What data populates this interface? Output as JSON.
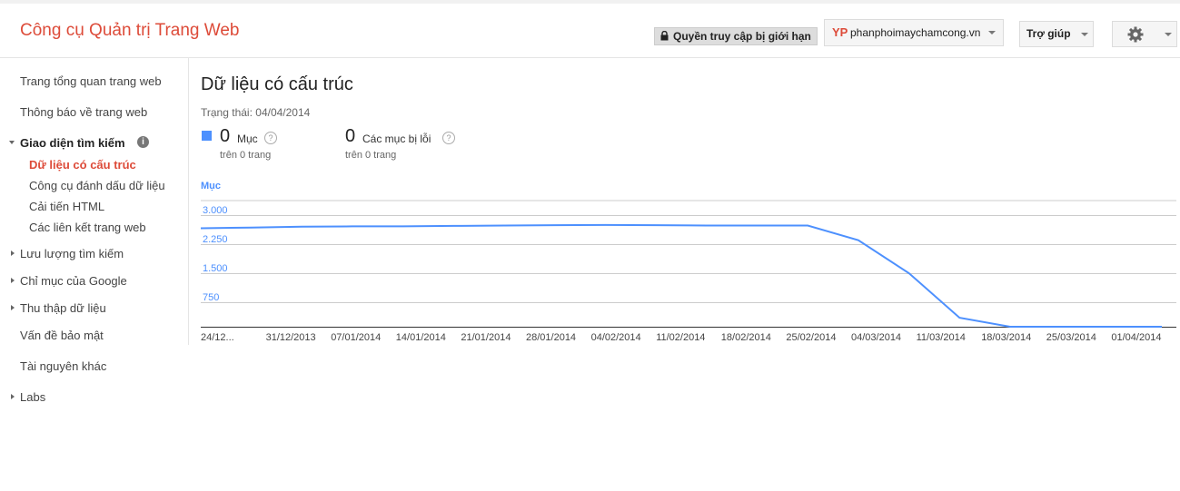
{
  "header": {
    "app_title": "Công cụ Quản trị Trang Web",
    "limited_access": "Quyền truy cập bị giới hạn",
    "site_logo": "YP",
    "site_name": "phanphoimaychamcong.vn",
    "help_label": "Trợ giúp"
  },
  "sidebar": {
    "overview": "Trang tổng quan trang web",
    "messages": "Thông báo về trang web",
    "search_appearance": "Giao diện tìm kiếm",
    "structured_data": "Dữ liệu có cấu trúc",
    "data_highlighter": "Công cụ đánh dấu dữ liệu",
    "html_improvements": "Cải tiến HTML",
    "sitelinks": "Các liên kết trang web",
    "search_traffic": "Lưu lượng tìm kiếm",
    "google_index": "Chỉ mục của Google",
    "crawl": "Thu thập dữ liệu",
    "security_issues": "Vấn đề bảo mật",
    "other_resources": "Tài nguyên khác",
    "labs": "Labs"
  },
  "main": {
    "title": "Dữ liệu có cấu trúc",
    "status_label": "Trạng thái:",
    "status_date": "04/04/2014",
    "metric_items": {
      "value": "0",
      "label": "Mục",
      "sub": "trên 0 trang"
    },
    "metric_errors": {
      "value": "0",
      "label": "Các mục bị lỗi",
      "sub": "trên 0 trang"
    }
  },
  "colors": {
    "accent": "#dd4b39",
    "series": "#4d90fe"
  },
  "chart_data": {
    "type": "line",
    "ylabel": "Mục",
    "y_ticks": [
      "3.000",
      "2.250",
      "1.500",
      "750"
    ],
    "y_tick_values": [
      3000,
      2250,
      1500,
      750
    ],
    "ylim": [
      0,
      3000
    ],
    "grid": true,
    "x_tick_labels": [
      "24/12...",
      "31/12/2013",
      "07/01/2014",
      "14/01/2014",
      "21/01/2014",
      "28/01/2014",
      "04/02/2014",
      "11/02/2014",
      "18/02/2014",
      "25/02/2014",
      "04/03/2014",
      "11/03/2014",
      "18/03/2014",
      "25/03/2014",
      "01/04/2014"
    ],
    "series": [
      {
        "values": [
          2660,
          2680,
          2700,
          2710,
          2710,
          2720,
          2730,
          2740,
          2745,
          2740,
          2730,
          2730,
          2730,
          2350,
          1500,
          350,
          0,
          0,
          0,
          0
        ]
      }
    ]
  }
}
